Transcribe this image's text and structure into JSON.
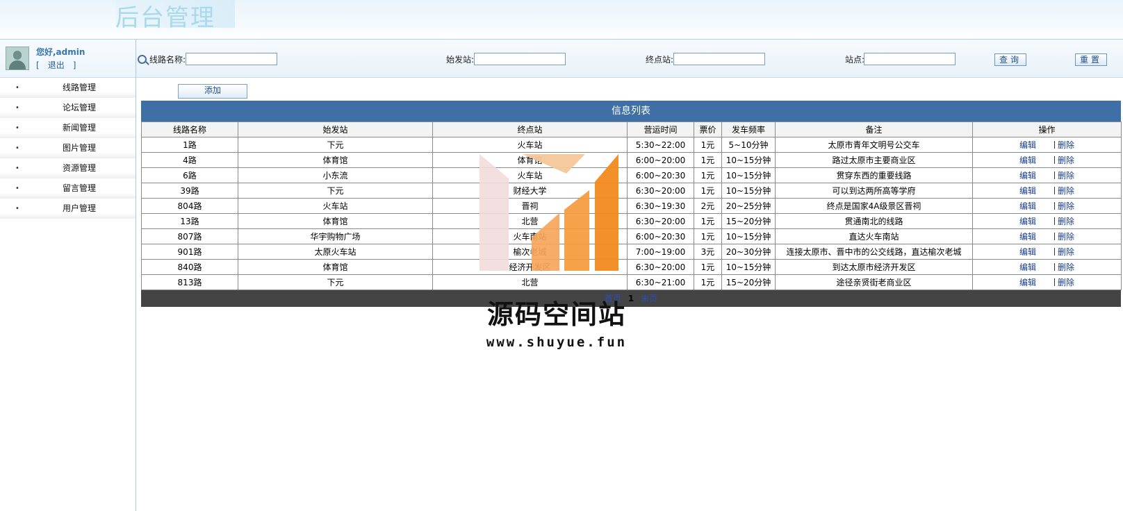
{
  "header": {
    "title": "后台管理"
  },
  "user": {
    "greeting": "您好,admin",
    "logout_open": "[",
    "logout": "退出",
    "logout_close": "]"
  },
  "menu": [
    {
      "label": "线路管理"
    },
    {
      "label": "论坛管理"
    },
    {
      "label": "新闻管理"
    },
    {
      "label": "图片管理"
    },
    {
      "label": "资源管理"
    },
    {
      "label": "留言管理"
    },
    {
      "label": "用户管理"
    }
  ],
  "search": {
    "route_label": "线路名称:",
    "start_label": "始发站:",
    "end_label": "终点站:",
    "stop_label": "站点:",
    "query_button": "查询",
    "reset_button": "重置",
    "route_value": "",
    "start_value": "",
    "end_value": "",
    "stop_value": ""
  },
  "add_button": "添加",
  "table": {
    "title": "信息列表",
    "columns": [
      "线路名称",
      "始发站",
      "终点站",
      "营运时间",
      "票价",
      "发车频率",
      "备注",
      "操作"
    ],
    "rows": [
      [
        "1路",
        "下元",
        "火车站",
        "5:30~22:00",
        "1元",
        "5~10分钟",
        "太原市青年文明号公交车"
      ],
      [
        "4路",
        "体育馆",
        "体育馆",
        "6:00~20:00",
        "1元",
        "10~15分钟",
        "路过太原市主要商业区"
      ],
      [
        "6路",
        "小东流",
        "火车站",
        "6:00~20:30",
        "1元",
        "10~15分钟",
        "贯穿东西的重要线路"
      ],
      [
        "39路",
        "下元",
        "财经大学",
        "6:30~20:00",
        "1元",
        "10~15分钟",
        "可以到达两所高等学府"
      ],
      [
        "804路",
        "火车站",
        "晋祠",
        "6:30~19:30",
        "2元",
        "20~25分钟",
        "终点是国家4A级景区晋祠"
      ],
      [
        "13路",
        "体育馆",
        "北营",
        "6:30~20:00",
        "1元",
        "15~20分钟",
        "贯通南北的线路"
      ],
      [
        "807路",
        "华宇购物广场",
        "火车南站",
        "6:00~20:30",
        "1元",
        "10~15分钟",
        "直达火车南站"
      ],
      [
        "901路",
        "太原火车站",
        "榆次老城",
        "7:00~19:00",
        "3元",
        "20~30分钟",
        "连接太原市、晋中市的公交线路，直达榆次老城"
      ],
      [
        "840路",
        "体育馆",
        "经济开发区",
        "6:30~20:00",
        "1元",
        "10~15分钟",
        "到达太原市经济开发区"
      ],
      [
        "813路",
        "下元",
        "北营",
        "6:30~21:00",
        "1元",
        "15~20分钟",
        "途径亲贤街老商业区"
      ]
    ],
    "edit_label": "编辑",
    "delete_label": "删除"
  },
  "pager": {
    "first": "首页",
    "current": "1",
    "last": "末页"
  },
  "watermark": {
    "name": "源码空间站",
    "url": "www.shuyue.fun"
  },
  "colors": {
    "accent": "#3e6fa6",
    "pager_bg": "#444444",
    "link": "#1a3d8f"
  }
}
